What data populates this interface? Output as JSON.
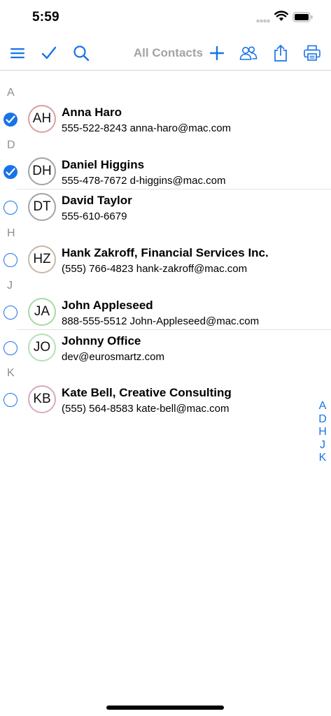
{
  "status_bar": {
    "time": "5:59"
  },
  "toolbar": {
    "title": "All Contacts"
  },
  "sections": {
    "A": "A",
    "D": "D",
    "H": "H",
    "J": "J",
    "K": "K"
  },
  "contacts": [
    {
      "initials": "AH",
      "name": "Anna Haro",
      "detail": "555-522-8243 anna-haro@mac.com",
      "checked": true,
      "avatar_color": "#d9a0a0"
    },
    {
      "initials": "DH",
      "name": "Daniel Higgins",
      "detail": "555-478-7672 d-higgins@mac.com",
      "checked": true,
      "avatar_color": "#a3a3a3"
    },
    {
      "initials": "DT",
      "name": "David Taylor",
      "detail": "555-610-6679",
      "checked": false,
      "avatar_color": "#a3a3a3"
    },
    {
      "initials": "HZ",
      "name": "Hank Zakroff, Financial Services Inc.",
      "detail": "(555) 766-4823 hank-zakroff@mac.com",
      "checked": false,
      "avatar_color": "#c9b8a8"
    },
    {
      "initials": "JA",
      "name": "John Appleseed",
      "detail": "888-555-5512 John-Appleseed@mac.com",
      "checked": false,
      "avatar_color": "#a8d8a8"
    },
    {
      "initials": "JO",
      "name": "Johnny Office",
      "detail": "dev@eurosmartz.com",
      "checked": false,
      "avatar_color": "#b7e0b7"
    },
    {
      "initials": "KB",
      "name": "Kate Bell, Creative Consulting",
      "detail": "(555) 564-8583 kate-bell@mac.com",
      "checked": false,
      "avatar_color": "#d9a9c0"
    }
  ],
  "index": [
    "A",
    "D",
    "H",
    "J",
    "K"
  ],
  "colors": {
    "accent": "#1a73e8",
    "title_gray": "#a3a3a3"
  },
  "icons": {
    "menu": "menu-icon",
    "select": "checkmark-icon",
    "search": "search-icon",
    "add": "plus-icon",
    "groups": "groups-icon",
    "share": "share-icon",
    "print": "print-icon"
  }
}
